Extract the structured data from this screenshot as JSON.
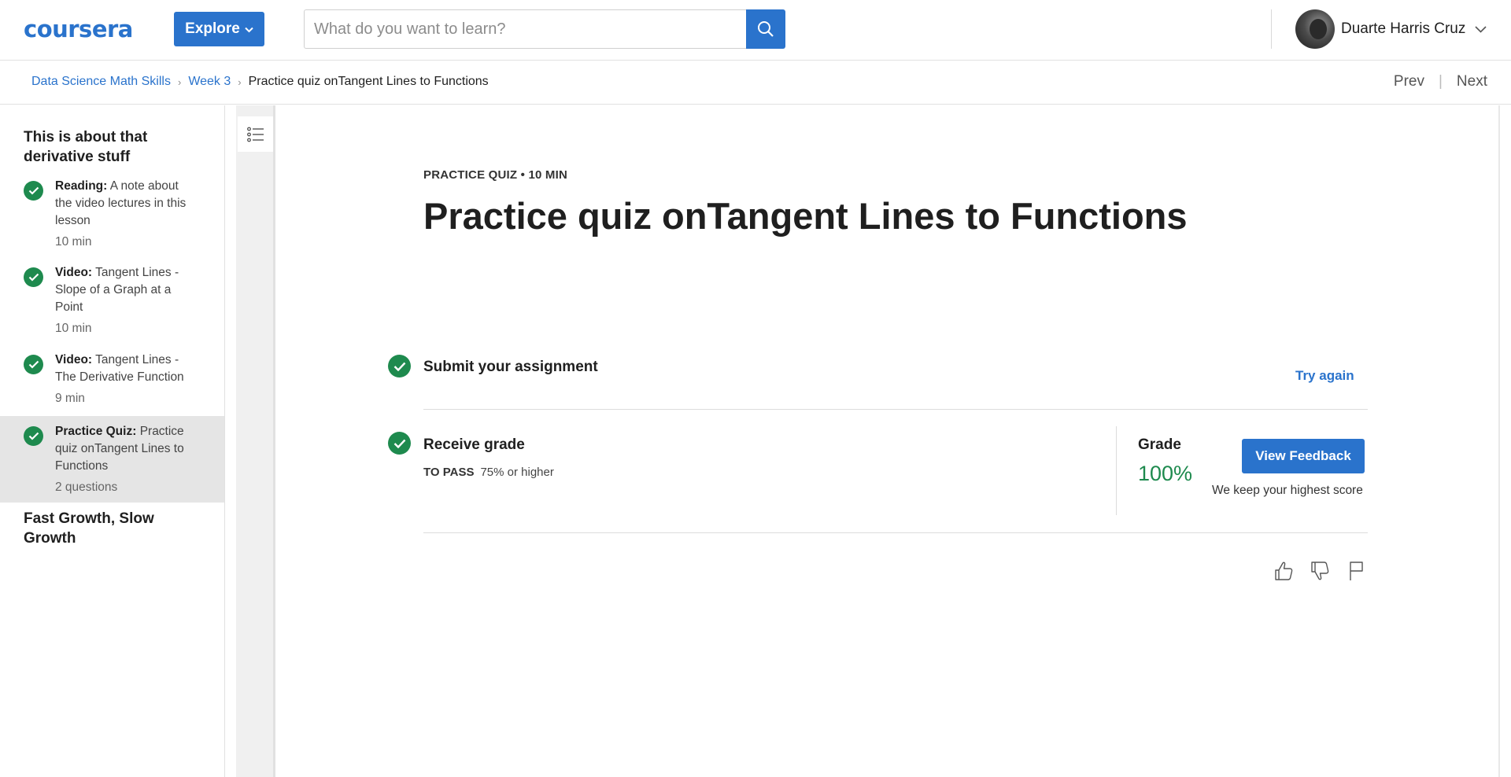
{
  "header": {
    "logo": "coursera",
    "explore_label": "Explore",
    "search_placeholder": "What do you want to learn?",
    "user_name": "Duarte Harris Cruz"
  },
  "breadcrumb": {
    "items": [
      "Data Science Math Skills",
      "Week 3"
    ],
    "current": "Practice quiz onTangent Lines to Functions"
  },
  "nav": {
    "prev": "Prev",
    "next": "Next"
  },
  "sidebar": {
    "module_title": "This is about that derivative stuff",
    "lessons": [
      {
        "type": "Reading:",
        "title": "A note about the video lectures in this lesson",
        "meta": "10 min"
      },
      {
        "type": "Video:",
        "title": "Tangent Lines - Slope of a Graph at a Point",
        "meta": "10 min"
      },
      {
        "type": "Video:",
        "title": "Tangent Lines - The Derivative Function",
        "meta": "9 min"
      },
      {
        "type": "Practice Quiz:",
        "title": "Practice quiz onTangent Lines to Functions",
        "meta": "2 questions"
      }
    ],
    "next_module_title": "Fast Growth, Slow Growth"
  },
  "main": {
    "kicker": "PRACTICE QUIZ • 10 MIN",
    "title": "Practice quiz onTangent Lines to Functions",
    "submit": {
      "title": "Submit your assignment",
      "action": "Try again"
    },
    "receive": {
      "title": "Receive grade",
      "to_pass_label": "TO PASS",
      "to_pass_value": "75% or higher",
      "grade_label": "Grade",
      "grade_value": "100%",
      "feedback_button": "View Feedback",
      "note": "We keep your highest score"
    }
  },
  "colors": {
    "accent": "#2a73cc",
    "success": "#1e8a4e"
  },
  "icons": [
    "search-icon",
    "chevron-down-icon",
    "list-icon",
    "check-icon",
    "thumbs-up-icon",
    "thumbs-down-icon",
    "flag-icon"
  ]
}
